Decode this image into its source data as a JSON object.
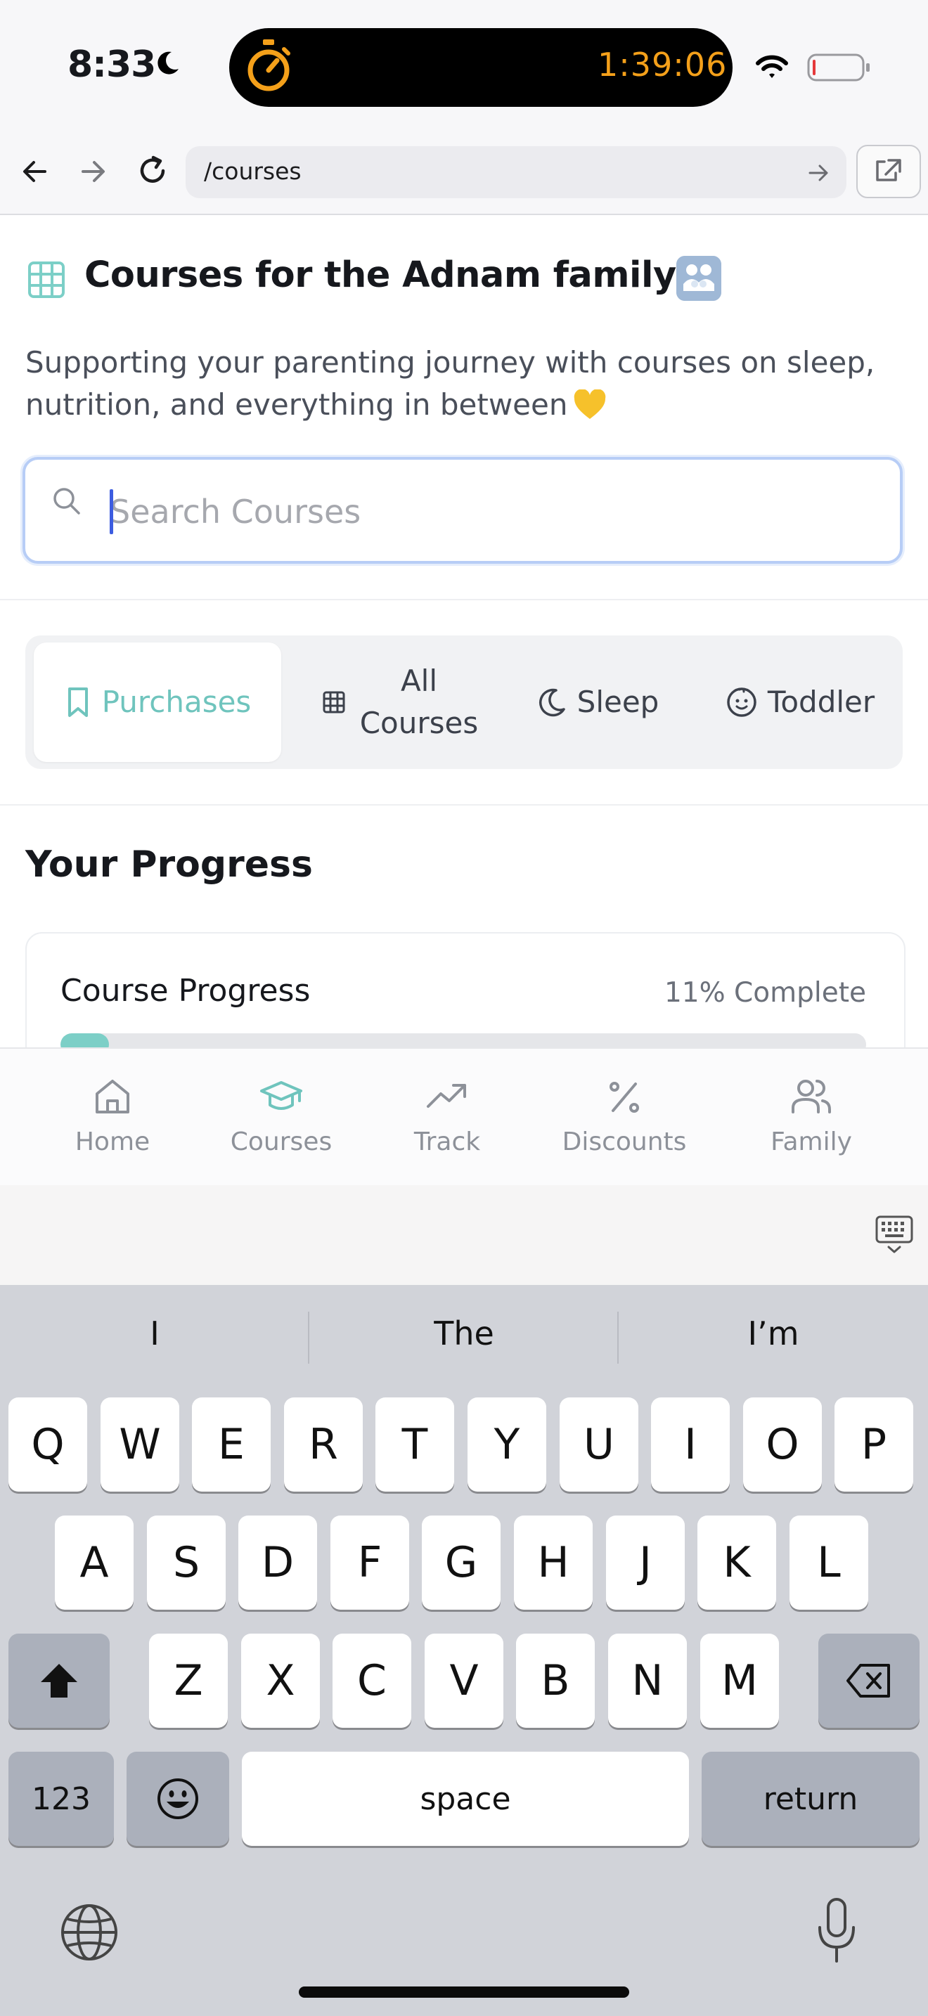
{
  "status_bar": {
    "time": "8:33",
    "timer": "1:39:06",
    "colors": {
      "timer": "#f4a01a",
      "battery_low": "#e5393b"
    }
  },
  "browser": {
    "url": "/courses"
  },
  "page": {
    "title": "Courses for the Adnam family",
    "subtitle": "Supporting your parenting journey with courses on sleep, nutrition, and everything in between",
    "search": {
      "placeholder": "Search Courses",
      "value": ""
    },
    "tabs": [
      {
        "label": "Purchases",
        "icon": "bookmark-icon",
        "active": true
      },
      {
        "label": "All Courses",
        "icon": "grid-icon",
        "active": false
      },
      {
        "label": "Sleep",
        "icon": "moon-icon",
        "active": false
      },
      {
        "label": "Toddler",
        "icon": "baby-face-icon",
        "active": false
      }
    ],
    "progress": {
      "heading": "Your Progress",
      "label": "Course Progress",
      "percent_text": "11% Complete",
      "percent": 0.06
    },
    "accent_color": "#6fc4bd"
  },
  "bottom_nav": {
    "items": [
      {
        "label": "Home",
        "icon": "home-icon",
        "active": false
      },
      {
        "label": "Courses",
        "icon": "graduation-cap-icon",
        "active": true
      },
      {
        "label": "Track",
        "icon": "trending-up-icon",
        "active": false
      },
      {
        "label": "Discounts",
        "icon": "percent-icon",
        "active": false
      },
      {
        "label": "Family",
        "icon": "users-icon",
        "active": false
      }
    ]
  },
  "keyboard": {
    "suggestions": [
      "I",
      "The",
      "I’m"
    ],
    "row1": [
      "Q",
      "W",
      "E",
      "R",
      "T",
      "Y",
      "U",
      "I",
      "O",
      "P"
    ],
    "row2": [
      "A",
      "S",
      "D",
      "F",
      "G",
      "H",
      "J",
      "K",
      "L"
    ],
    "row3": [
      "Z",
      "X",
      "C",
      "V",
      "B",
      "N",
      "M"
    ],
    "numbers_key": "123",
    "space_key": "space",
    "return_key": "return"
  }
}
